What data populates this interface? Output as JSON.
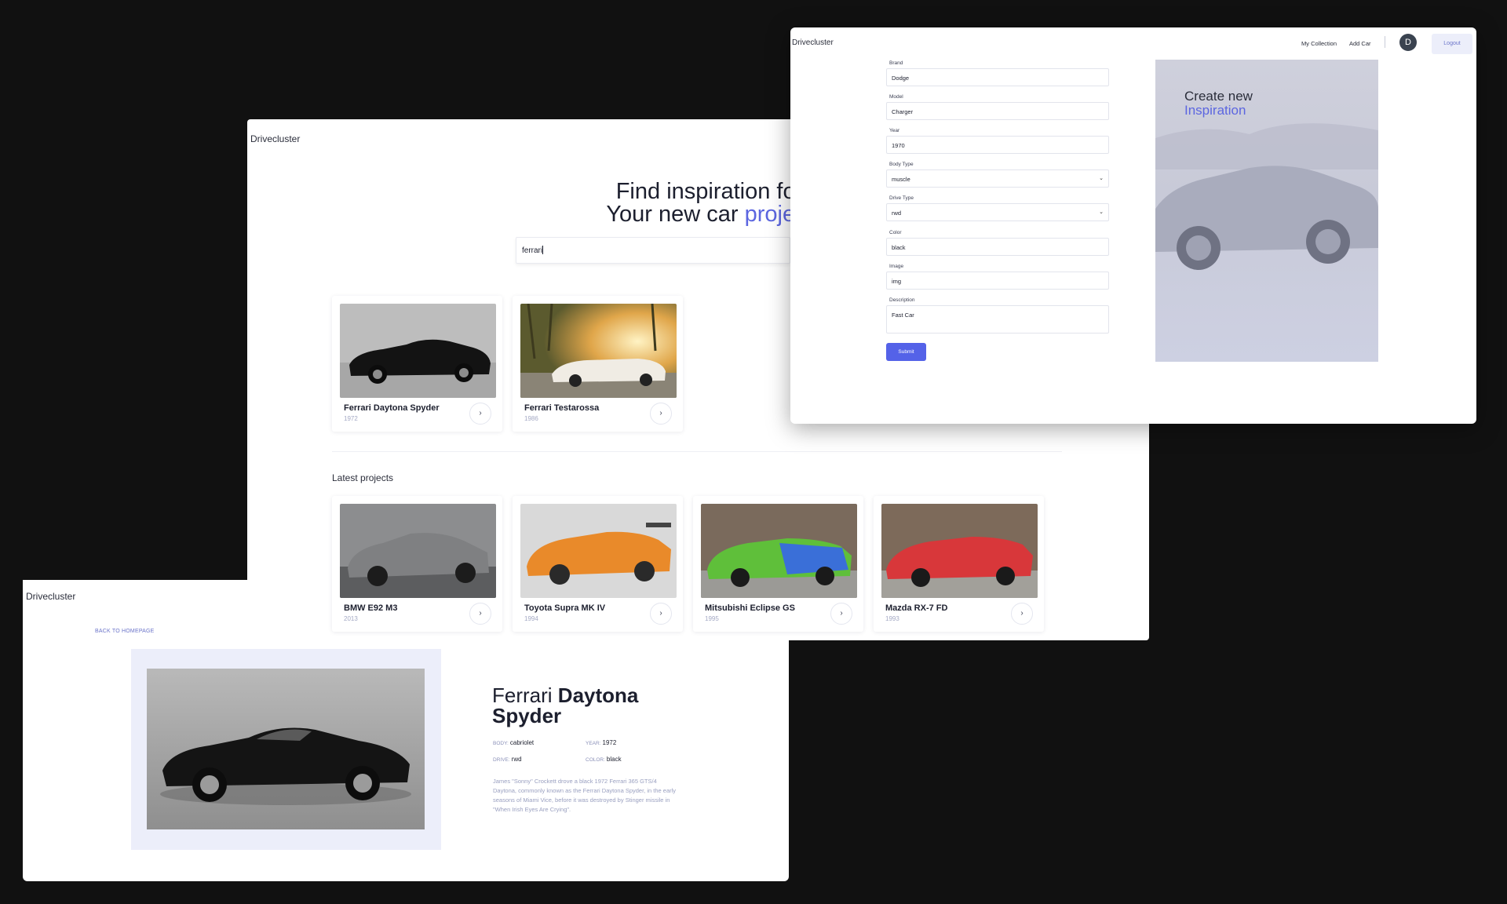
{
  "detail_window": {
    "brand": "Drivecluster",
    "back_link": "BACK TO HOMEPAGE",
    "title_light": "Ferrari",
    "title_bold": "Daytona Spyder",
    "specs": {
      "body_label": "BODY:",
      "body_value": "cabriolet",
      "year_label": "YEAR:",
      "year_value": "1972",
      "drive_label": "DRIVE:",
      "drive_value": "rwd",
      "color_label": "COLOR:",
      "color_value": "black"
    },
    "description": "James \"Sonny\" Crockett drove a black 1972 Ferrari 365 GTS/4 Daytona, commonly known as the Ferrari Daytona Spyder, in the early seasons of Miami Vice, before it was destroyed by Stinger missile in \"When Irish Eyes Are Crying\"."
  },
  "home_window": {
    "brand": "Drivecluster",
    "hero_line1": "Find inspiration for",
    "hero_line2_prefix": "Your new car ",
    "hero_line2_accent": "project",
    "search_value": "ferrari",
    "search_results": [
      {
        "name": "Ferrari Daytona Spyder",
        "year": "1972",
        "icon": "chevron-right-icon"
      },
      {
        "name": "Ferrari Testarossa",
        "year": "1986",
        "icon": "chevron-right-icon"
      }
    ],
    "latest_title": "Latest projects",
    "latest": [
      {
        "name": "BMW E92 M3",
        "year": "2013",
        "icon": "chevron-right-icon"
      },
      {
        "name": "Toyota Supra MK IV",
        "year": "1994",
        "icon": "chevron-right-icon"
      },
      {
        "name": "Mitsubishi Eclipse GS",
        "year": "1995",
        "icon": "chevron-right-icon"
      },
      {
        "name": "Mazda RX-7 FD",
        "year": "1993",
        "icon": "chevron-right-icon"
      }
    ],
    "chevron": "›"
  },
  "form_window": {
    "brand": "Drivecluster",
    "nav": {
      "collection": "My Collection",
      "add_car": "Add Car",
      "avatar_initial": "D",
      "logout": "Logout"
    },
    "fields": {
      "brand_label": "Brand",
      "brand_value": "Dodge",
      "model_label": "Model",
      "model_value": "Charger",
      "year_label": "Year",
      "year_value": "1970",
      "body_label": "Body Type",
      "body_value": "muscle",
      "drive_label": "Drive Type",
      "drive_value": "rwd",
      "color_label": "Color",
      "color_value": "black",
      "image_label": "Image",
      "image_value": "img",
      "desc_label": "Description",
      "desc_value": "Fast Car"
    },
    "submit": "Submit",
    "side_title_line1": "Create new",
    "side_title_line2": "Inspiration"
  },
  "colors": {
    "accent": "#5c66e0",
    "button": "#5462e8",
    "background": "#111111"
  }
}
